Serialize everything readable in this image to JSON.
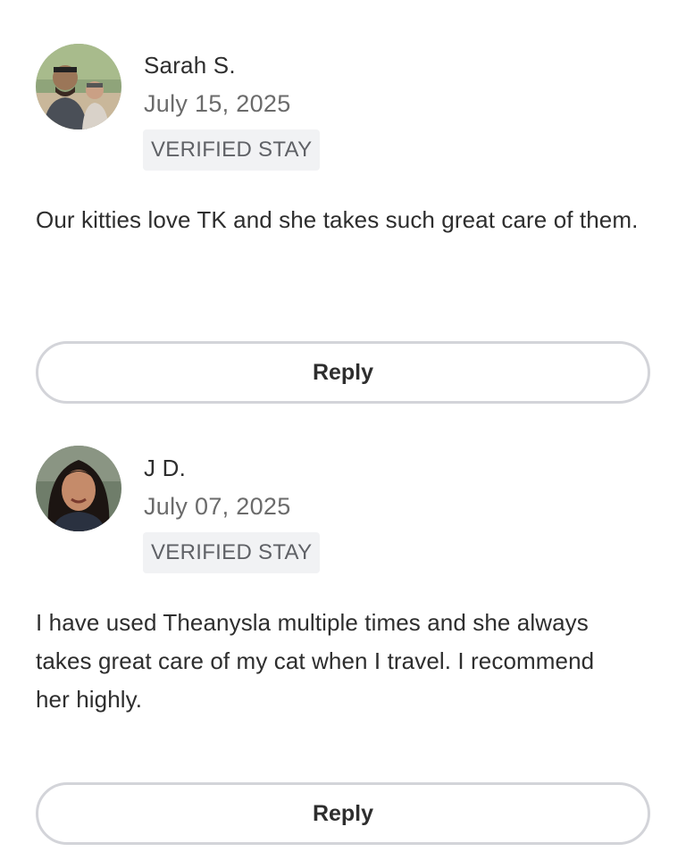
{
  "reviews": [
    {
      "name": "Sarah S.",
      "date": "July 15, 2025",
      "badge": "VERIFIED STAY",
      "text": "Our kitties love TK and she takes such great care of them.",
      "reply_label": "Reply",
      "avatar_icon": "profile-photo-couple"
    },
    {
      "name": "J D.",
      "date": "July 07, 2025",
      "badge": "VERIFIED STAY",
      "text": "I have used Theanysla multiple times and she always takes great care of my cat when I travel. I recommend her highly.",
      "reply_label": "Reply",
      "avatar_icon": "profile-photo-woman"
    }
  ],
  "colors": {
    "border": "#d3d4d9",
    "badge_bg": "#f1f2f4",
    "text_primary": "#2e2e2e",
    "text_secondary": "#6b6b6b"
  }
}
